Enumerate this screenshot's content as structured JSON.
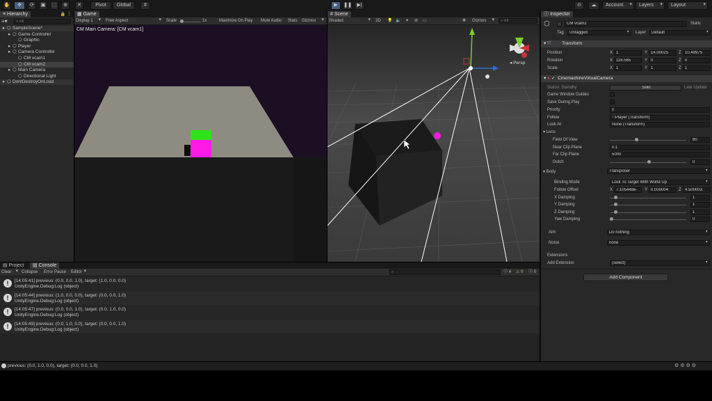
{
  "toolbar": {
    "pivot": "Pivot",
    "global": "Global",
    "account": "Account",
    "layers": "Layers",
    "layout": "Layout"
  },
  "hierarchy": {
    "tab": "Hierarchy",
    "search_placeholder": "All",
    "items": [
      {
        "label": "SampleScene*",
        "depth": 0
      },
      {
        "label": "Game Controller",
        "depth": 1
      },
      {
        "label": "Graphic",
        "depth": 2
      },
      {
        "label": "Player",
        "depth": 1
      },
      {
        "label": "Camera Controller",
        "depth": 1
      },
      {
        "label": "CM vcam1",
        "depth": 2
      },
      {
        "label": "CM vcam2",
        "depth": 2
      },
      {
        "label": "Main Camera",
        "depth": 1
      },
      {
        "label": "Directional Light",
        "depth": 2
      },
      {
        "label": "DontDestroyOnLoad",
        "depth": 0
      }
    ]
  },
  "game": {
    "tab": "Game",
    "display": "Display 1",
    "aspect": "Free Aspect",
    "scale_label": "Scale",
    "scale_value": "1x",
    "maximize": "Maximize On Play",
    "mute": "Mute Audio",
    "stats": "Stats",
    "gizmos": "Gizmos",
    "overlay": "CM Main Camera: [CM vcam1]"
  },
  "scene": {
    "tab": "Scene",
    "shading": "Shaded",
    "mode2d": "2D",
    "gizmos": "Gizmos",
    "search_placeholder": "All",
    "persp": "Persp"
  },
  "console": {
    "tab_project": "Project",
    "tab_console": "Console",
    "clear": "Clear",
    "collapse": "Collapse",
    "error_pause": "Error Pause",
    "editor": "Editor",
    "count_info": "4",
    "count_warn": "0",
    "count_error": "0",
    "entries": [
      {
        "line1": "[14:05:41] previous: (0.0, 0.0, 1.0), target: (1.0, 0.0, 0.0)",
        "line2": "UnityEngine.Debug:Log (object)"
      },
      {
        "line1": "[14:05:44] previous: (1.0, 0.0, 0.0), target: (0.0, 0.0, 1.0)",
        "line2": "UnityEngine.Debug:Log (object)"
      },
      {
        "line1": "[14:05:47] previous: (0.0, 0.0, 1.0), target: (0.0, 1.0, 0.0)",
        "line2": "UnityEngine.Debug:Log (object)"
      },
      {
        "line1": "[14:05:49] previous: (0.0, 1.0, 0.0), target: (0.0, 0.0, 1.0)",
        "line2": "UnityEngine.Debug:Log (object)"
      }
    ],
    "status": "previous: (0.0, 1.0, 0.0), target: (0.0, 0.0, 1.0)"
  },
  "inspector": {
    "tab": "Inspector",
    "object_name": "CM vcam2",
    "static": "Static",
    "tag_label": "Tag",
    "tag_value": "Untagged",
    "layer_label": "Layer",
    "layer_value": "Default",
    "transform": {
      "title": "Transform",
      "position": "Position",
      "rotation": "Rotation",
      "scale": "Scale",
      "pos": {
        "x": "1",
        "y": "14.00025",
        "z": "10.49975"
      },
      "rot": {
        "x": "116.565",
        "y": "0",
        "z": "0"
      },
      "scl": {
        "x": "1",
        "y": "1",
        "z": "1"
      }
    },
    "vcam": {
      "title": "CinemachineVirtualCamera",
      "status_label": "Status: Standby",
      "solo": "Solo",
      "late_update": "Late Update",
      "game_window_guides": "Game Window Guides",
      "save_during_play": "Save During Play",
      "priority_label": "Priority",
      "priority_value": "0",
      "follow_label": "Follow",
      "follow_value": "Player (Transform)",
      "lookat_label": "Look At",
      "lookat_value": "None (Transform)",
      "lens_label": "Lens",
      "fov_label": "Field Of View",
      "fov_value": "80",
      "near_label": "Near Clip Plane",
      "near_value": "0.1",
      "far_label": "Far Clip Plane",
      "far_value": "5000",
      "dutch_label": "Dutch",
      "dutch_value": "0",
      "body_label": "Body",
      "body_value": "Transposer",
      "binding_label": "Binding Mode",
      "binding_value": "Lock To Target With World Up",
      "offset_label": "Follow Offset",
      "offset": {
        "x": "7.105448e-",
        "y": "0.000004",
        "z": "4.500003"
      },
      "xdamp_label": "X Damping",
      "xdamp_value": "1",
      "ydamp_label": "Y Damping",
      "ydamp_value": "1",
      "zdamp_label": "Z Damping",
      "zdamp_value": "1",
      "yawdamp_label": "Yaw Damping",
      "yawdamp_value": "0",
      "aim_label": "Aim",
      "aim_value": "Do nothing",
      "noise_label": "Noise",
      "noise_value": "none",
      "extensions_label": "Extensions",
      "add_ext_label": "Add Extension",
      "add_ext_value": "(select)"
    },
    "add_component": "Add Component"
  },
  "colors": {
    "panel": "#282828",
    "header": "#3a3a3a",
    "selection": "#46607c",
    "game_bg": "#1c0f24",
    "cube_green": "#2fe31c",
    "cube_magenta": "#ff1ae6"
  }
}
